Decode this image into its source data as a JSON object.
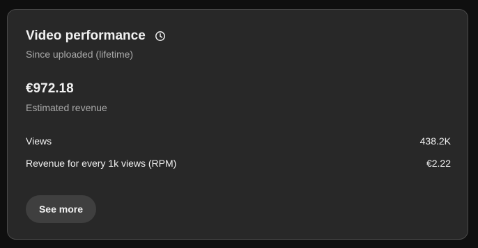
{
  "card": {
    "title": "Video performance",
    "info_icon": "clock-history-icon",
    "subtitle": "Since uploaded (lifetime)",
    "revenue_value": "€972.18",
    "revenue_label": "Estimated revenue",
    "metrics": [
      {
        "label": "Views",
        "value": "438.2K"
      },
      {
        "label": "Revenue for every 1k views (RPM)",
        "value": "€2.22"
      }
    ],
    "see_more_label": "See more"
  },
  "colors": {
    "background": "#0f0f0f",
    "card": "#282828",
    "card_border": "#4a4a4a",
    "text_primary": "#f1f1f1",
    "text_secondary": "#aaaaaa",
    "button": "#3f3f3f"
  }
}
